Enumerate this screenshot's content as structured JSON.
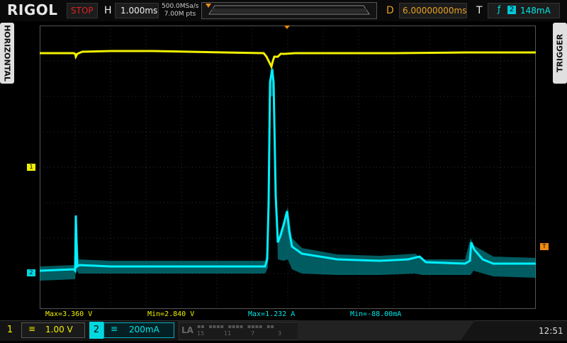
{
  "brand": "RIGOL",
  "run_state": "STOP",
  "horizontal": {
    "letter": "H",
    "timebase": "1.000ms",
    "sample_rate": "500.0MSa/s",
    "memory_depth": "7.00M pts"
  },
  "delay": {
    "letter": "D",
    "value": "6.00000000ms"
  },
  "trigger": {
    "letter": "T",
    "edge_icon": "rising-edge-icon",
    "edge_glyph": "ƒ",
    "source": "2",
    "level": "148mA"
  },
  "side_tabs": {
    "left": "HORIZONTAL",
    "right": "TRIGGER"
  },
  "markers": {
    "ch1": "1",
    "ch2": "2",
    "trigger_level": "T",
    "trigger_pos": "T"
  },
  "measurements": [
    {
      "text": "Max=3.360 V"
    },
    {
      "text": "Min=2.840 V"
    },
    {
      "text": "Max=1.232 A"
    },
    {
      "text": "Min=-88.00mA"
    }
  ],
  "channels": [
    {
      "num": "1",
      "coupling": "≡",
      "scale": "1.00 V",
      "color": "#f0f000"
    },
    {
      "num": "2",
      "coupling": "≡",
      "scale": "200mA",
      "color": "#00e5e5"
    }
  ],
  "la": {
    "label": "LA",
    "digits": [
      "15",
      "11",
      "7",
      "3"
    ]
  },
  "clock": "12:51",
  "colors": {
    "ch1": "#f0f000",
    "ch2": "#00e5e5",
    "trigger": "#f08a10",
    "run_state": "#dd2222"
  }
}
